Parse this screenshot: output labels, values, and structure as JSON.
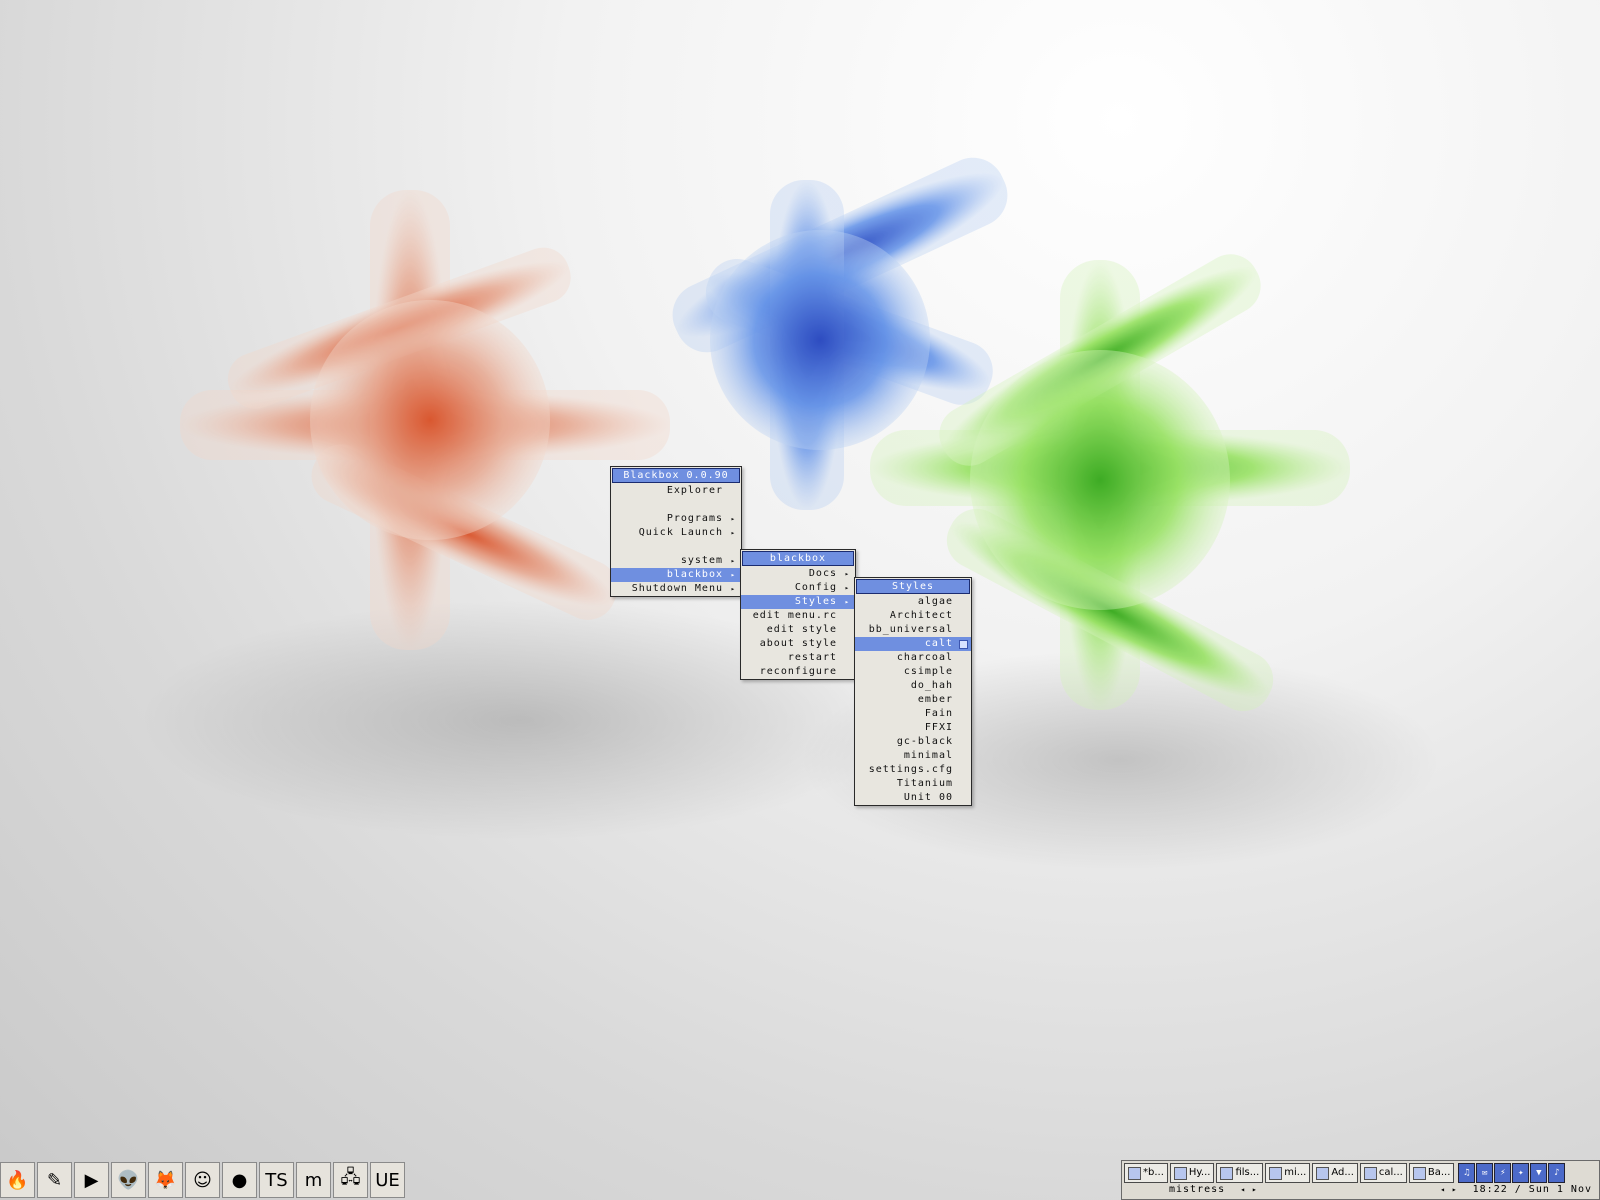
{
  "menus": {
    "root": {
      "title": "Blackbox 0.0.90",
      "items": [
        {
          "label": "Explorer",
          "sub": false
        },
        {
          "label": "",
          "gap": true
        },
        {
          "label": "Programs",
          "sub": true
        },
        {
          "label": "Quick Launch",
          "sub": true
        },
        {
          "label": "",
          "gap": true
        },
        {
          "label": "system",
          "sub": true
        },
        {
          "label": "blackbox",
          "sub": true,
          "active": true
        },
        {
          "label": "Shutdown Menu",
          "sub": true
        }
      ]
    },
    "blackbox": {
      "title": "blackbox",
      "items": [
        {
          "label": "Docs",
          "sub": true
        },
        {
          "label": "Config",
          "sub": true
        },
        {
          "label": "Styles",
          "sub": true,
          "active": true
        },
        {
          "label": "edit menu.rc",
          "sub": false
        },
        {
          "label": "edit style",
          "sub": false
        },
        {
          "label": "about style",
          "sub": false
        },
        {
          "label": "restart",
          "sub": false
        },
        {
          "label": "reconfigure",
          "sub": false
        }
      ]
    },
    "styles": {
      "title": "Styles",
      "items": [
        {
          "label": "algae"
        },
        {
          "label": "Architect"
        },
        {
          "label": "bb_universal"
        },
        {
          "label": "calt",
          "active": true,
          "checked": true
        },
        {
          "label": "charcoal"
        },
        {
          "label": "csimple"
        },
        {
          "label": "do_hah"
        },
        {
          "label": "ember"
        },
        {
          "label": "Fain"
        },
        {
          "label": "FFXI"
        },
        {
          "label": "gc-black"
        },
        {
          "label": "minimal"
        },
        {
          "label": "settings.cfg"
        },
        {
          "label": "Titanium"
        },
        {
          "label": "Unit 00"
        }
      ]
    }
  },
  "launchbar": [
    {
      "icon": "fire-keyboard-icon",
      "glyph": "🔥"
    },
    {
      "icon": "quill-icon",
      "glyph": "✎"
    },
    {
      "icon": "media-player-icon",
      "glyph": "▶"
    },
    {
      "icon": "alien-icon",
      "glyph": "👽"
    },
    {
      "icon": "firefox-icon",
      "glyph": "🦊"
    },
    {
      "icon": "messenger-icon",
      "glyph": "☺"
    },
    {
      "icon": "bowling-icon",
      "glyph": "●"
    },
    {
      "icon": "ts-icon",
      "glyph": "TS"
    },
    {
      "icon": "m-app-icon",
      "glyph": "m"
    },
    {
      "icon": "network-computer-icon",
      "glyph": "🖧"
    },
    {
      "icon": "ultraedit-icon",
      "glyph": "UE"
    }
  ],
  "taskbar": {
    "tasks": [
      "*b...",
      "Hy...",
      "fils...",
      "mi...",
      "Ad...",
      "cal...",
      "Ba..."
    ],
    "tray": [
      {
        "icon": "headset-icon",
        "glyph": "♫"
      },
      {
        "icon": "mail-icon",
        "glyph": "✉"
      },
      {
        "icon": "pdf-icon",
        "glyph": "⚡"
      },
      {
        "icon": "tool-icon",
        "glyph": "✦"
      },
      {
        "icon": "network-icon",
        "glyph": "▼"
      },
      {
        "icon": "volume-icon",
        "glyph": "♪"
      }
    ],
    "workspace": "mistress",
    "workspace_arrows": "◂ ▸",
    "clock_arrows": "◂ ▸",
    "clock": "18:22 / Sun 1 Nov"
  }
}
